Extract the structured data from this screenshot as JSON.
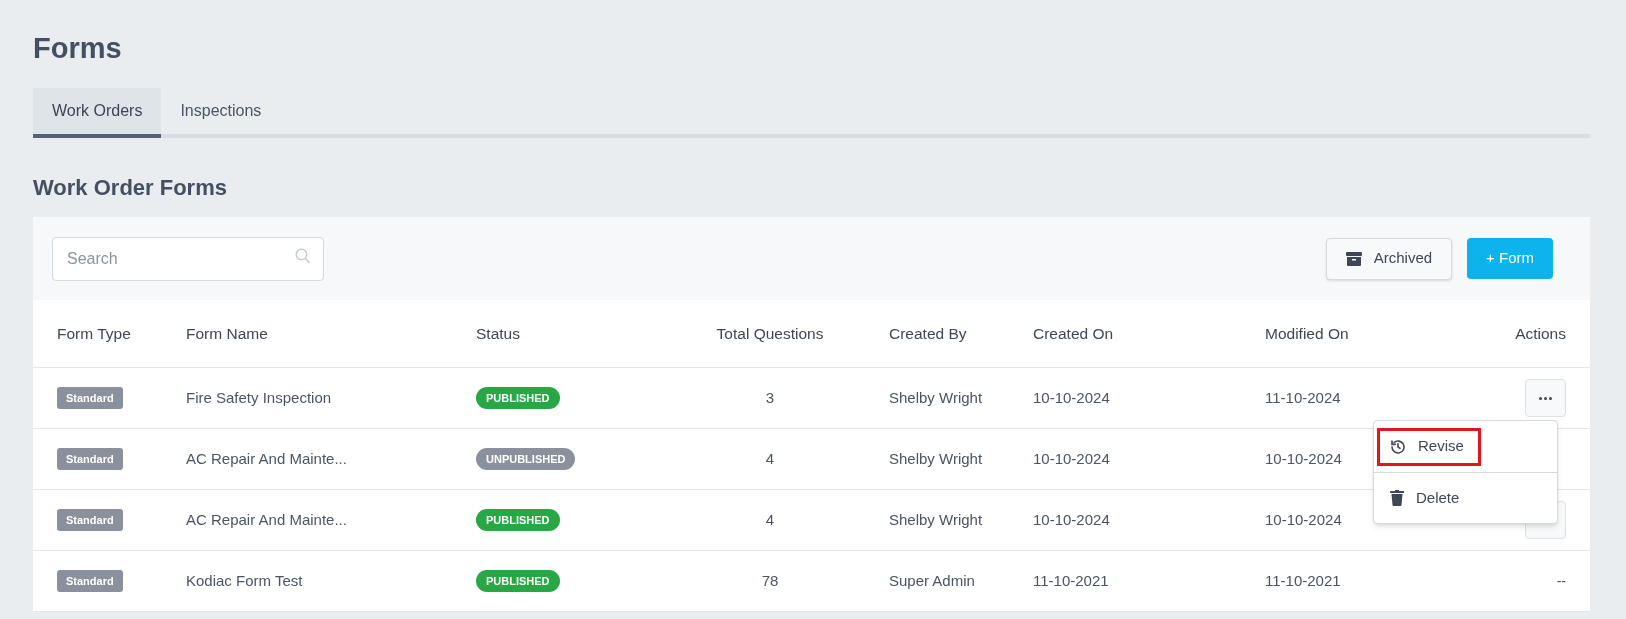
{
  "page_title": "Forms",
  "tabs": [
    {
      "label": "Work Orders",
      "selected": true
    },
    {
      "label": "Inspections",
      "selected": false
    }
  ],
  "section_title": "Work Order Forms",
  "search": {
    "placeholder": "Search"
  },
  "buttons": [
    {
      "kind": "archived",
      "label": "Archived"
    },
    {
      "kind": "add",
      "label": "+ Form"
    }
  ],
  "table": {
    "columns": [
      "Form Type",
      "Form Name",
      "Status",
      "Total Questions",
      "Created By",
      "Created On",
      "Modified On",
      "Actions"
    ],
    "rows": [
      {
        "form_type": "Standard",
        "form_name": "Fire Safety Inspection",
        "status": {
          "label": "PUBLISHED",
          "color": "#28a745"
        },
        "total_questions": "3",
        "created_by": "Shelby Wright",
        "created_on": "10-10-2024",
        "modified_on": "11-10-2024",
        "action": {
          "kind": "menu"
        }
      },
      {
        "form_type": "Standard",
        "form_name": "AC Repair And Mainte...",
        "status": {
          "label": "UNPUBLISHED",
          "color": "#8a919c"
        },
        "total_questions": "4",
        "created_by": "Shelby Wright",
        "created_on": "10-10-2024",
        "modified_on": "10-10-2024",
        "action": {
          "kind": "none"
        }
      },
      {
        "form_type": "Standard",
        "form_name": "AC Repair And Mainte...",
        "status": {
          "label": "PUBLISHED",
          "color": "#28a745"
        },
        "total_questions": "4",
        "created_by": "Shelby Wright",
        "created_on": "10-10-2024",
        "modified_on": "10-10-2024",
        "action": {
          "kind": "menu"
        }
      },
      {
        "form_type": "Standard",
        "form_name": "Kodiac Form Test",
        "status": {
          "label": "PUBLISHED",
          "color": "#28a745"
        },
        "total_questions": "78",
        "created_by": "Super Admin",
        "created_on": "11-10-2021",
        "modified_on": "11-10-2021",
        "action": {
          "kind": "text",
          "label": "--"
        }
      }
    ]
  },
  "action_menu": {
    "items": [
      {
        "kind": "revise",
        "label": "Revise",
        "highlighted": true
      },
      {
        "kind": "delete",
        "label": "Delete",
        "highlighted": false
      }
    ]
  }
}
